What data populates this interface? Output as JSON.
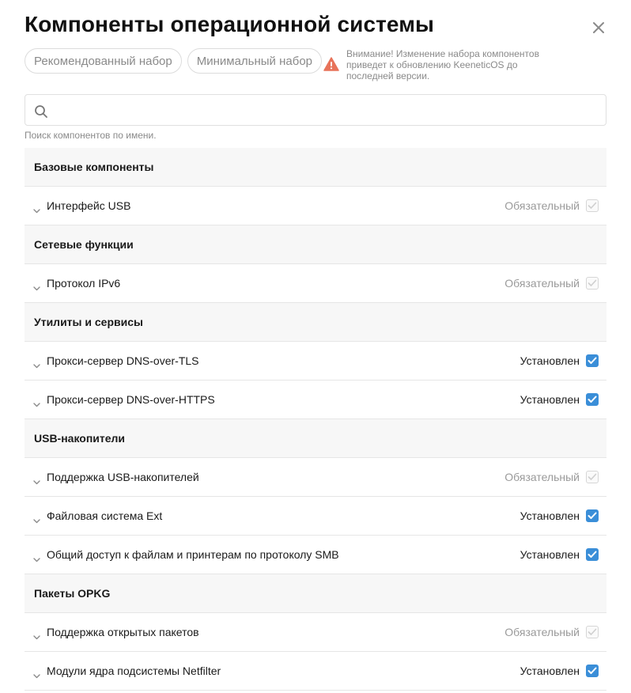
{
  "dialog": {
    "title": "Компоненты операционной системы",
    "presets": {
      "recommended_label": "Рекомендованный набор",
      "minimal_label": "Минимальный набор"
    },
    "warning_text": "Внимание! Изменение набора компонентов приведет к обновлению KeeneticOS до последней версии.",
    "warning_icon": "warning-triangle-icon",
    "warning_color": "#e8735a"
  },
  "search": {
    "value": "",
    "placeholder": "",
    "hint": "Поиск компонентов по имени."
  },
  "colors": {
    "accent": "#3a8ed8",
    "group_bg": "#f7f7f7"
  },
  "groups": [
    {
      "title": "Базовые компоненты",
      "items": [
        {
          "label": "Интерфейс USB",
          "status": "Обязательный",
          "state": "required"
        }
      ]
    },
    {
      "title": "Сетевые функции",
      "items": [
        {
          "label": "Протокол IPv6",
          "status": "Обязательный",
          "state": "required"
        }
      ]
    },
    {
      "title": "Утилиты и сервисы",
      "items": [
        {
          "label": "Прокси-сервер DNS-over-TLS",
          "status": "Установлен",
          "state": "installed"
        },
        {
          "label": "Прокси-сервер DNS-over-HTTPS",
          "status": "Установлен",
          "state": "installed"
        }
      ]
    },
    {
      "title": "USB-накопители",
      "items": [
        {
          "label": "Поддержка USB-накопителей",
          "status": "Обязательный",
          "state": "required"
        },
        {
          "label": "Файловая система Ext",
          "status": "Установлен",
          "state": "installed"
        },
        {
          "label": "Общий доступ к файлам и принтерам по протоколу SMB",
          "status": "Установлен",
          "state": "installed"
        }
      ]
    },
    {
      "title": "Пакеты OPKG",
      "items": [
        {
          "label": "Поддержка открытых пакетов",
          "status": "Обязательный",
          "state": "required"
        },
        {
          "label": "Модули ядра подсистемы Netfilter",
          "status": "Установлен",
          "state": "installed"
        }
      ]
    }
  ]
}
